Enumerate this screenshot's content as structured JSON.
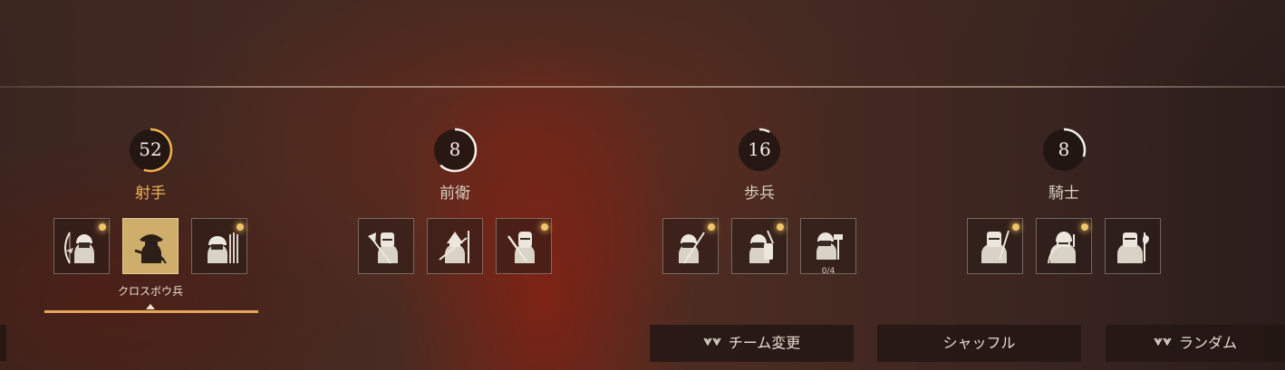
{
  "groups": [
    {
      "id": "archers",
      "count": "52",
      "title": "射手",
      "active": true,
      "progress": 0.55,
      "ring_color": "#f0b24c",
      "selected_unit_label": "クロスボウ兵",
      "units": [
        {
          "icon": "archer-bow-icon",
          "dot": true,
          "selected": false
        },
        {
          "icon": "crossbowman-icon",
          "dot": false,
          "selected": true
        },
        {
          "icon": "javelin-thrower-icon",
          "dot": true,
          "selected": false
        }
      ]
    },
    {
      "id": "vanguard",
      "count": "8",
      "title": "前衛",
      "active": false,
      "progress": 0.62,
      "ring_color": "#f2ede6",
      "units": [
        {
          "icon": "axe-warrior-icon",
          "dot": false,
          "selected": false
        },
        {
          "icon": "dual-swords-warrior-icon",
          "dot": false,
          "selected": false
        },
        {
          "icon": "knight-sword-icon",
          "dot": true,
          "selected": false
        }
      ]
    },
    {
      "id": "infantry",
      "count": "16",
      "title": "歩兵",
      "active": false,
      "progress": 0.08,
      "ring_color": "#f2ede6",
      "units": [
        {
          "icon": "spearman-torch-icon",
          "dot": true,
          "selected": false
        },
        {
          "icon": "shield-infantry-icon",
          "dot": true,
          "selected": false
        },
        {
          "icon": "hammer-infantry-icon",
          "dot": false,
          "selected": false,
          "count": "0/4"
        }
      ]
    },
    {
      "id": "knights",
      "count": "8",
      "title": "騎士",
      "active": false,
      "progress": 0.3,
      "ring_color": "#f2ede6",
      "units": [
        {
          "icon": "armored-knight-sword-icon",
          "dot": true,
          "selected": false
        },
        {
          "icon": "knight-mace-icon",
          "dot": true,
          "selected": false
        },
        {
          "icon": "knight-axe-icon",
          "dot": false,
          "selected": false
        }
      ]
    }
  ],
  "buttons": {
    "change_team": {
      "label": "チーム変更",
      "icon": "team-swap-icon"
    },
    "shuffle": {
      "label": "シャッフル"
    },
    "random": {
      "label": "ランダム",
      "icon": "team-swap-icon"
    }
  },
  "colors": {
    "accent": "#e8a55a",
    "active_title": "#e8b25c",
    "selected_tile": "#cfad6a",
    "dot": "#f0c46a"
  }
}
